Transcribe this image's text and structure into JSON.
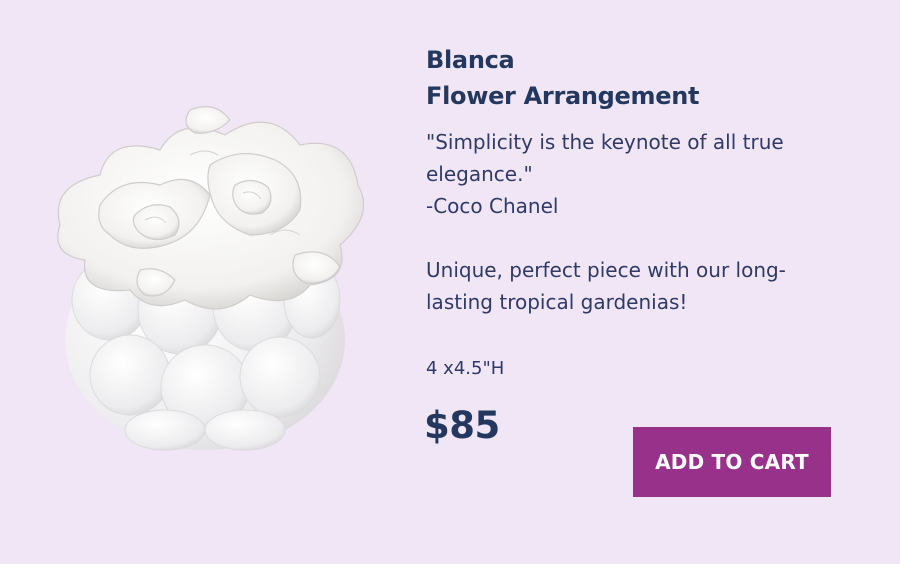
{
  "product": {
    "title_line1": "Blanca",
    "title_line2": "Flower Arrangement",
    "quote_line1": "\"Simplicity is the keynote of all true",
    "quote_line2": "elegance.\"",
    "quote_author": "-Coco Chanel",
    "description_line1": "Unique, perfect piece with our long-",
    "description_line2": "lasting tropical gardenias!",
    "size": "4 x4.5\"H",
    "price": "$85",
    "image_icon": "white-gardenia-arrangement-image"
  },
  "actions": {
    "add_to_cart_label": "ADD TO CART"
  },
  "colors": {
    "background": "#f1e6f6",
    "text": "#2b3a63",
    "button": "#98318a",
    "button_text": "#ffffff"
  }
}
